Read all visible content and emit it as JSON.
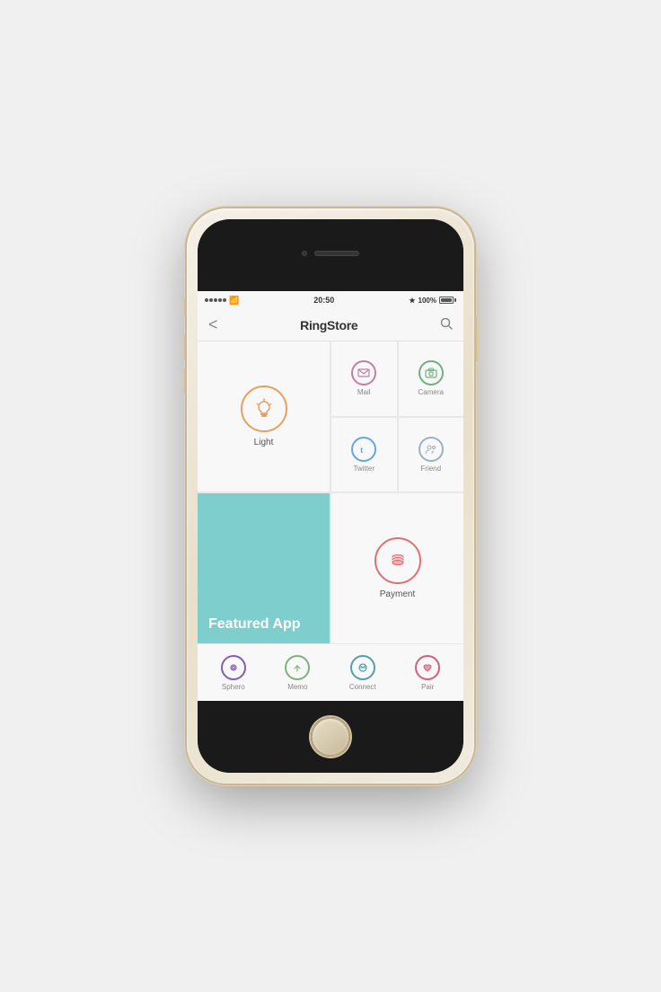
{
  "phone": {
    "status": {
      "time": "20:50",
      "battery": "100%",
      "bluetooth": "BT"
    },
    "nav": {
      "back": "<",
      "title": "RingStore",
      "search": "🔍"
    },
    "apps": {
      "light": {
        "label": "Light",
        "circle_color": "#e8a060"
      },
      "featured": {
        "label": "Featured App",
        "bg_color": "#7ecece"
      },
      "mail": {
        "label": "Mail"
      },
      "camera": {
        "label": "Camera"
      },
      "twitter": {
        "label": "Twitter"
      },
      "friend": {
        "label": "Friend"
      },
      "payment": {
        "label": "Payment"
      },
      "sphero": {
        "label": "Sphero"
      },
      "memo": {
        "label": "Memo"
      },
      "connect": {
        "label": "Connect"
      },
      "pair": {
        "label": "Pair"
      }
    }
  }
}
